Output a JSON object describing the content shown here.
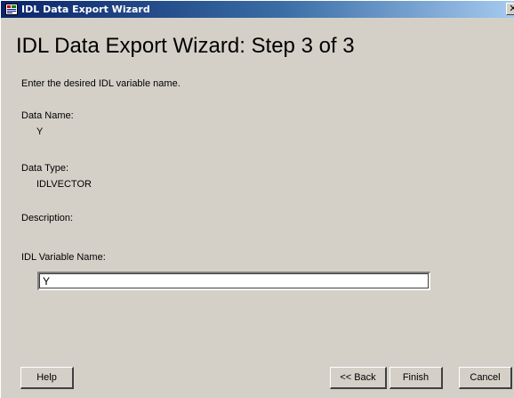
{
  "window": {
    "title": "IDL Data Export Wizard",
    "close_glyph": "✕"
  },
  "page": {
    "heading": "IDL Data Export Wizard: Step 3 of 3",
    "instruction": "Enter the desired IDL variable name."
  },
  "fields": {
    "data_name_label": "Data Name:",
    "data_name_value": "Y",
    "data_type_label": "Data Type:",
    "data_type_value": "IDLVECTOR",
    "description_label": "Description:",
    "variable_name_label": "IDL Variable Name:",
    "variable_name_value": "Y"
  },
  "buttons": {
    "help": "Help",
    "back": "<< Back",
    "finish": "Finish",
    "cancel": "Cancel"
  },
  "colors": {
    "titlebar_start": "#0a246a",
    "titlebar_end": "#a6caf0",
    "dialog_background": "#d4d0c8"
  },
  "icons": {
    "app_icon": "idl-app-icon",
    "close_icon": "close-icon"
  }
}
